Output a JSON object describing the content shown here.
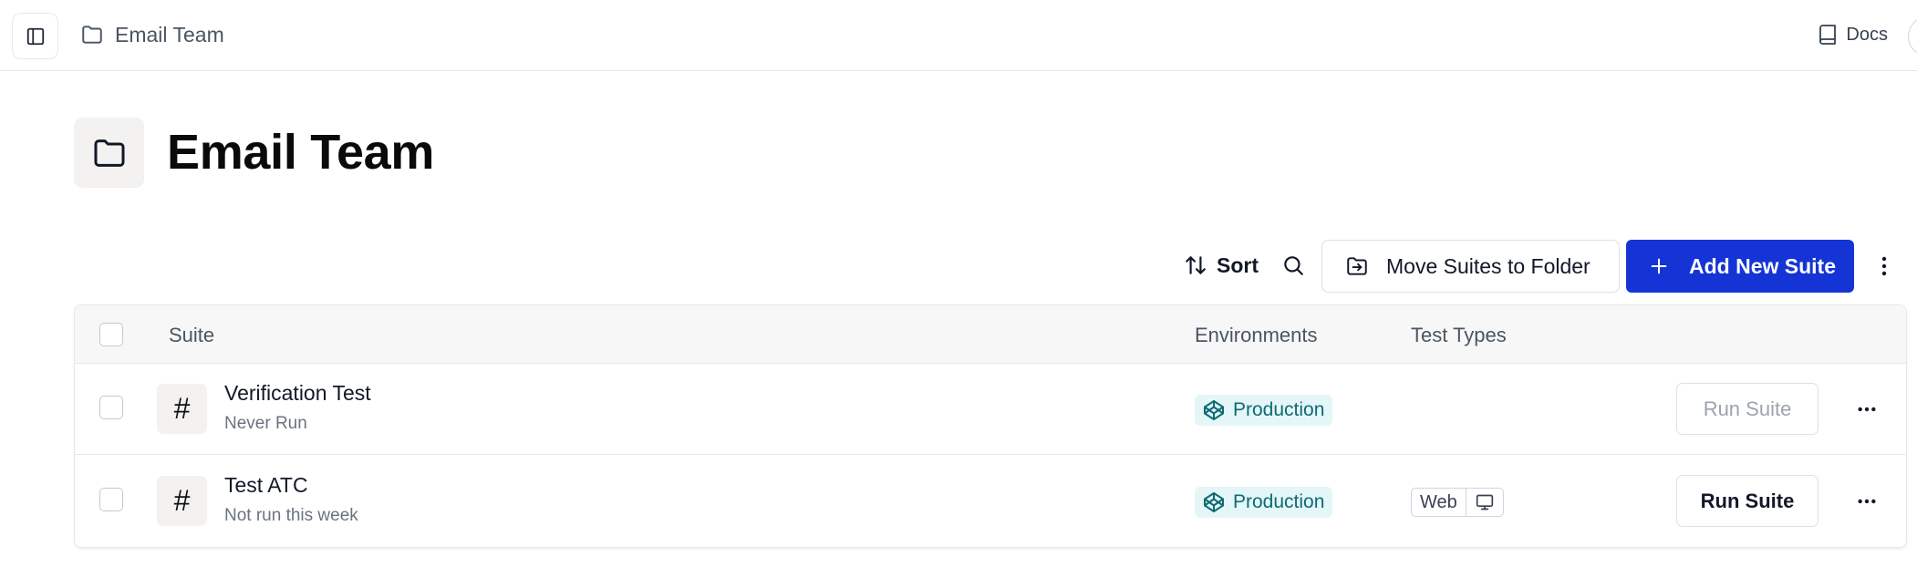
{
  "topbar": {
    "breadcrumb_label": "Email Team",
    "docs_label": "Docs"
  },
  "header": {
    "title": "Email Team"
  },
  "toolbar": {
    "sort_label": "Sort",
    "move_label": "Move Suites to Folder",
    "add_label": "Add New Suite"
  },
  "table": {
    "columns": {
      "suite": "Suite",
      "environments": "Environments",
      "test_types": "Test Types"
    },
    "rows": [
      {
        "name": "Verification Test",
        "status": "Never Run",
        "environment": "Production",
        "test_type": "",
        "run_label": "Run Suite",
        "run_enabled": false
      },
      {
        "name": "Test ATC",
        "status": "Not run this week",
        "environment": "Production",
        "test_type": "Web",
        "run_label": "Run Suite",
        "run_enabled": true
      }
    ]
  },
  "colors": {
    "primary": "#1534d6",
    "environment_badge_bg": "#e4f6f8",
    "environment_badge_text": "#0e6b73"
  },
  "icons": {
    "sidebar_toggle": "sidebar-toggle-icon",
    "breadcrumb": "folder-icon",
    "docs": "book-icon",
    "sort": "sort-arrows-icon",
    "search": "search-icon",
    "move": "folder-move-icon",
    "add": "plus-icon",
    "more": "more-horizontal-icon",
    "suite": "hash-icon",
    "environment": "codepen-icon",
    "web": "monitor-icon"
  }
}
